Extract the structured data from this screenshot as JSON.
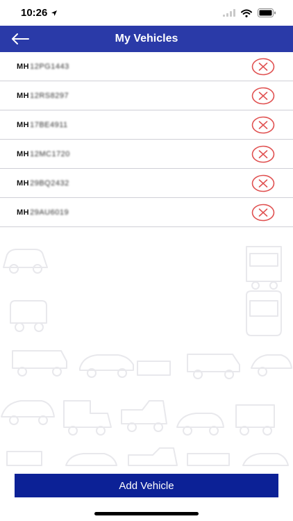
{
  "status": {
    "time": "10:26"
  },
  "nav": {
    "title": "My Vehicles"
  },
  "vehicles": [
    {
      "state": "MH",
      "rest": "12PG1443"
    },
    {
      "state": "MH",
      "rest": "12RS8297"
    },
    {
      "state": "MH",
      "rest": "17BE4911"
    },
    {
      "state": "MH",
      "rest": "12MC1720"
    },
    {
      "state": "MH",
      "rest": "29BQ2432"
    },
    {
      "state": "MH",
      "rest": "29AU6019"
    }
  ],
  "footer": {
    "add_label": "Add Vehicle"
  },
  "colors": {
    "nav": "#2a3aa8",
    "button": "#0c2196",
    "delete": "#e05050"
  },
  "icons": [
    "location-arrow-icon",
    "signal-icon",
    "wifi-icon",
    "battery-icon",
    "back-arrow-icon",
    "delete-icon"
  ]
}
